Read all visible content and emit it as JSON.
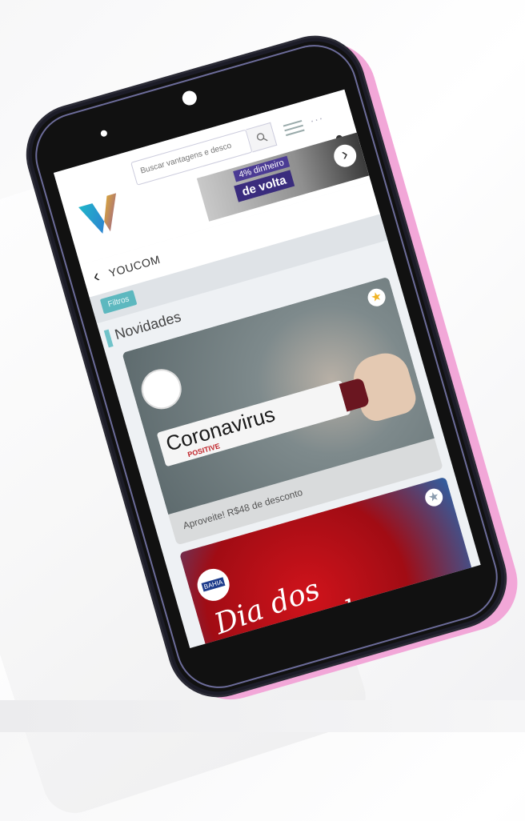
{
  "header": {
    "search_placeholder": "Buscar vantagens e desco",
    "dots": "···",
    "banner_line1": "4% dinheiro",
    "banner_line2": "de volta",
    "banner_next": "›"
  },
  "brand": {
    "back_label": "‹",
    "name": "YOUCOM"
  },
  "filters": {
    "button_label": "Filtros"
  },
  "section": {
    "title": "Novidades"
  },
  "cards": [
    {
      "image_text": "Coronavirus",
      "image_subtext": "POSITIVE",
      "caption": "Aproveite! R$48 de desconto",
      "favorite_icon": "star-icon"
    },
    {
      "image_text": "Dia dos Namorados",
      "store_label": "BAHIA",
      "favorite_icon": "star-icon"
    }
  ],
  "colors": {
    "accent": "#5db8bf",
    "banner": "#3a2c7d",
    "pink_edge": "#f2a7d8"
  }
}
